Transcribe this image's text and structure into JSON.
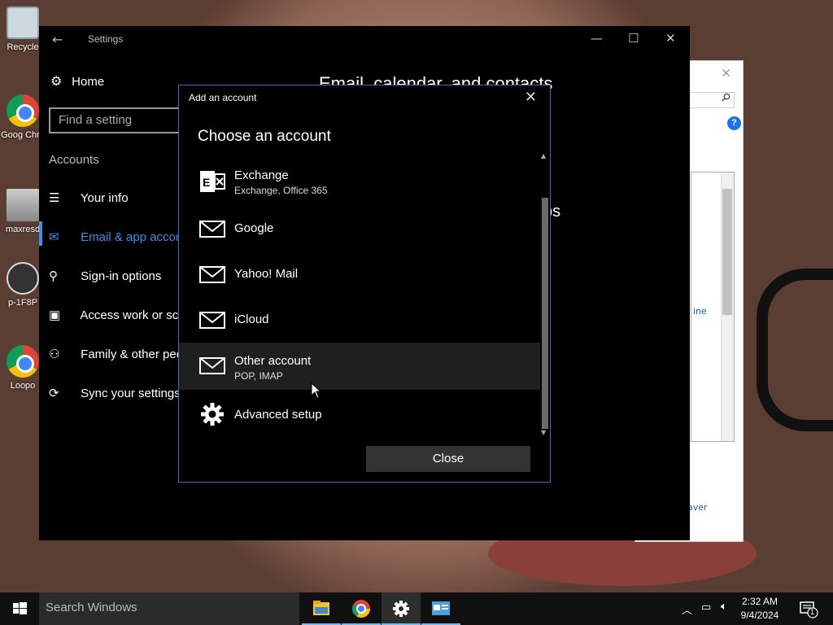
{
  "desktop": {
    "icons": [
      {
        "label": "Recycle"
      },
      {
        "label": "Goog Chro"
      },
      {
        "label": "maxresd"
      },
      {
        "label": "p-1F8P"
      },
      {
        "label": "Loopo"
      }
    ]
  },
  "background_window": {
    "close": "✕",
    "help": "?",
    "link1": "ine",
    "link2": "aver"
  },
  "settings": {
    "title": "Settings",
    "back": "←",
    "home_label": "Home",
    "search_placeholder": "Find a setting",
    "group_label": "Accounts",
    "nav": [
      {
        "label": "Your info"
      },
      {
        "label": "Email & app accou"
      },
      {
        "label": "Sign-in options"
      },
      {
        "label": "Access work or sch"
      },
      {
        "label": "Family & other peo"
      },
      {
        "label": "Sync your settings"
      }
    ],
    "heading": "Email, calendar, and contacts",
    "peek_text": "ps"
  },
  "dialog": {
    "title": "Add an account",
    "heading": "Choose an account",
    "accounts": [
      {
        "name": "Exchange",
        "sub": "Exchange, Office 365"
      },
      {
        "name": "Google",
        "sub": ""
      },
      {
        "name": "Yahoo! Mail",
        "sub": ""
      },
      {
        "name": "iCloud",
        "sub": ""
      },
      {
        "name": "Other account",
        "sub": "POP, IMAP"
      },
      {
        "name": "Advanced setup",
        "sub": ""
      }
    ],
    "close_button": "Close"
  },
  "taskbar": {
    "search_placeholder": "Search Windows",
    "time": "2:32 AM",
    "date": "9/4/2024",
    "notifications_count": "1"
  },
  "colors": {
    "accent": "#3f8fe4",
    "dialog_border": "#3c6dc4",
    "taskbar": "#101010"
  }
}
